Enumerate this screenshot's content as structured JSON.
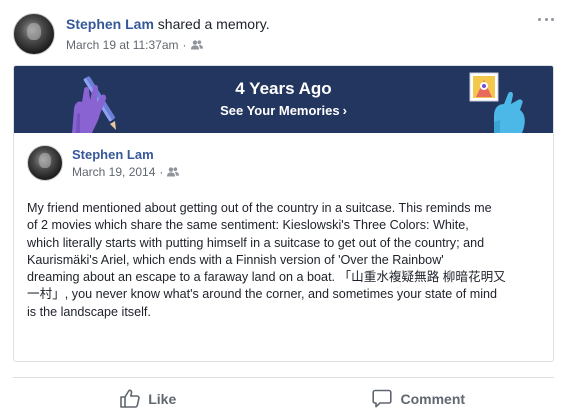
{
  "post": {
    "author": "Stephen Lam",
    "action": "shared a memory.",
    "timestamp": "March 19 at 11:37am",
    "separator": "·",
    "audience_icon": "friends-icon",
    "more_icon": "ellipsis-icon"
  },
  "memory": {
    "banner_title": "4 Years Ago",
    "banner_link": "See Your Memories",
    "banner_link_icon": "chevron-right-icon",
    "banner_color": "#23365f"
  },
  "shared": {
    "author": "Stephen Lam",
    "date": "March 19, 2014",
    "separator": "·",
    "audience_icon": "friends-icon",
    "text_lines": [
      "My friend mentioned about getting out of the country in a suitcase. This reminds me",
      "of 2 movies which share the same sentiment: Kieslowski's Three Colors: White,",
      "which literally starts with putting himself in a suitcase to get out of the country; and",
      "Kaurismäki's Ariel, which ends with a Finnish version of 'Over the Rainbow'",
      "dreaming about an escape to a faraway land on a boat. 「山重水複疑無路 柳暗花明又",
      "一村」, you never know what's around the corner, and sometimes your state of mind",
      "is the landscape itself."
    ]
  },
  "actions": {
    "like_label": "Like",
    "like_icon": "thumbs-up-icon",
    "comment_label": "Comment",
    "comment_icon": "comment-bubble-icon"
  },
  "colors": {
    "link_blue": "#365899",
    "meta_gray": "#616770",
    "text": "#1d2129"
  }
}
